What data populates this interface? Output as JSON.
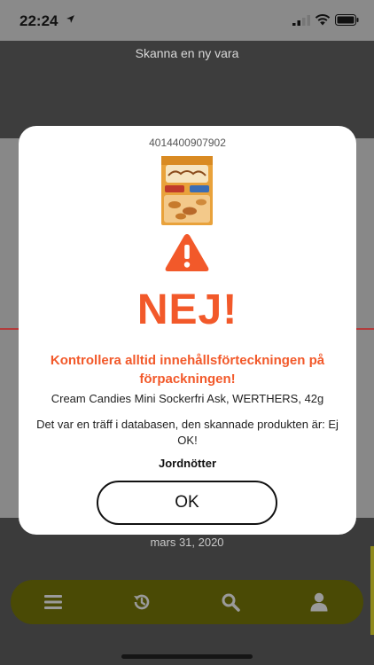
{
  "status_bar": {
    "time": "22:24"
  },
  "screen": {
    "title": "Skanna en ny vara",
    "date": "mars 31, 2020"
  },
  "modal": {
    "barcode": "4014400907902",
    "verdict": "NEJ!",
    "warning": "Kontrollera alltid innehållsförteckningen på förpackningen!",
    "product_name": "Cream Candies Mini Sockerfri Ask, WERTHERS, 42g",
    "db_message": "Det var en träff i databasen, den skannade produkten är: Ej OK!",
    "allergen": "Jordnötter",
    "ok_label": "OK"
  },
  "nav": {
    "items": [
      {
        "icon": "menu-icon"
      },
      {
        "icon": "history-icon"
      },
      {
        "icon": "search-icon"
      },
      {
        "icon": "user-icon"
      }
    ]
  },
  "colors": {
    "accent": "#f2592a",
    "nav_bg": "#4a4a05",
    "nav_icon": "#9a9a9a"
  }
}
